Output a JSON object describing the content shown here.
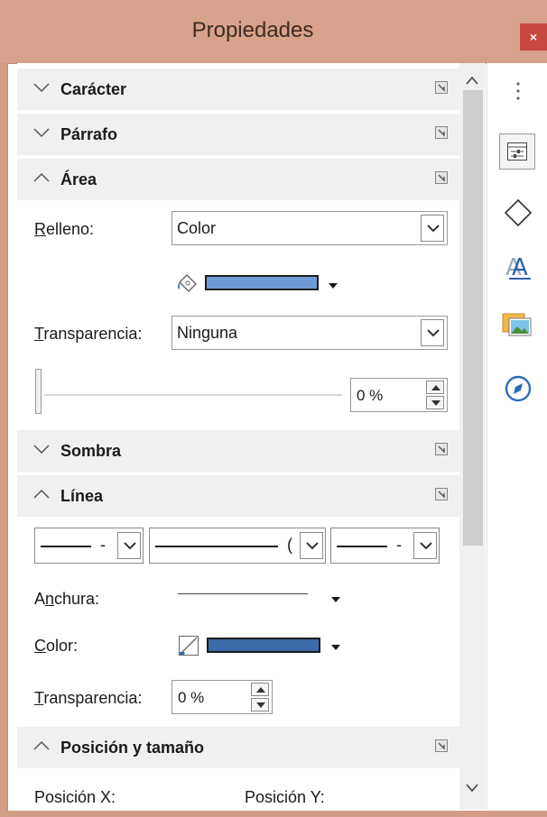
{
  "window": {
    "title": "Propiedades",
    "close_glyph": "×"
  },
  "sections": {
    "caracter": {
      "title": "Carácter"
    },
    "parrafo": {
      "title": "Párrafo"
    },
    "area": {
      "title": "Área",
      "relleno_label_first": "R",
      "relleno_label_rest": "elleno:",
      "relleno_value": "Color",
      "fill_color": "#6c9bd5",
      "transparencia_label_first": "T",
      "transparencia_label_rest": "ransparencia:",
      "transparencia_value": "Ninguna",
      "percent_value": "0 %"
    },
    "sombra": {
      "title": "Sombra"
    },
    "linea": {
      "title": "Línea",
      "style_combo_1": "-",
      "style_combo_2": "(",
      "style_combo_3": "-",
      "anchura_label_a": "A",
      "anchura_label_n": "n",
      "anchura_label_rest": "chura:",
      "color_label_first": "C",
      "color_label_rest": "olor:",
      "line_color": "#3a6ba8",
      "transparencia_label_first": "T",
      "transparencia_label_rest": "ransparencia:",
      "transparencia_value": "0 %"
    },
    "posicion": {
      "title": "Posición y tamaño",
      "pos_x_label": "Posición X:",
      "pos_y_label": "Posición Y:"
    }
  },
  "sidebar_tabs": [
    {
      "icon": "properties-icon"
    },
    {
      "icon": "styles-icon"
    },
    {
      "icon": "fontwork-icon"
    },
    {
      "icon": "gallery-icon"
    },
    {
      "icon": "navigator-icon"
    }
  ],
  "colors": {
    "titlebar": "#d8a18c",
    "close": "#c7483e",
    "section_header": "#f0f0f0"
  }
}
